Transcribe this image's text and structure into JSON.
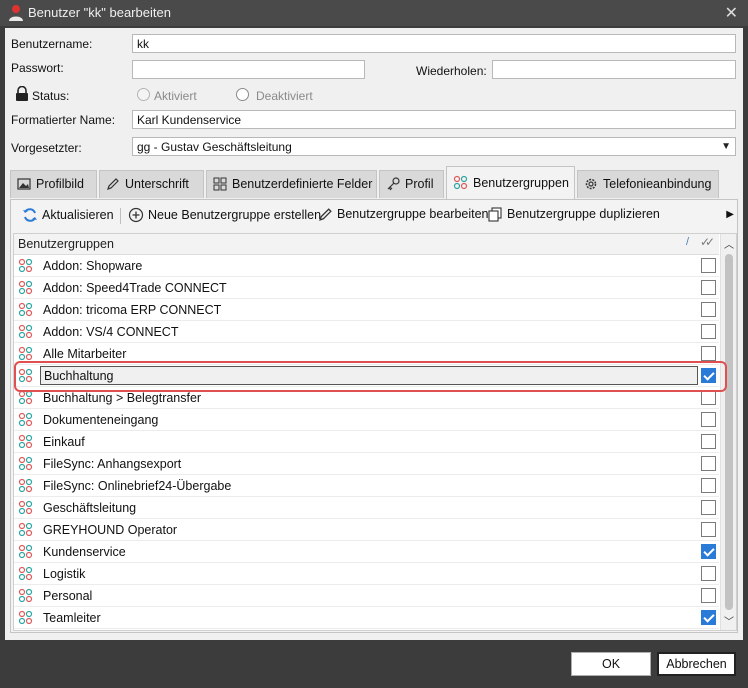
{
  "window": {
    "title": "Benutzer \"kk\" bearbeiten"
  },
  "form": {
    "username_label": "Benutzername:",
    "username_value": "kk",
    "password_label": "Passwort:",
    "password_value": "",
    "repeat_label": "Wiederholen:",
    "repeat_value": "",
    "status_label": "Status:",
    "status_active": "Aktiviert",
    "status_inactive": "Deaktiviert",
    "formatted_name_label": "Formatierter Name:",
    "formatted_name_value": "Karl Kundenservice",
    "supervisor_label": "Vorgesetzter:",
    "supervisor_value": "gg - Gustav Geschäftsleitung"
  },
  "tabs": [
    {
      "label": "Profilbild",
      "icon": "image-icon"
    },
    {
      "label": "Unterschrift",
      "icon": "pen-icon"
    },
    {
      "label": "Benutzerdefinierte Felder",
      "icon": "grid-icon"
    },
    {
      "label": "Profil",
      "icon": "key-icon"
    },
    {
      "label": "Benutzergruppen",
      "icon": "group-icon",
      "active": true
    },
    {
      "label": "Telefonieanbindung",
      "icon": "gear-icon"
    }
  ],
  "toolbar": {
    "refresh": "Aktualisieren",
    "new_group": "Neue Benutzergruppe erstellen",
    "edit_group": "Benutzergruppe bearbeiten",
    "duplicate_group": "Benutzergruppe duplizieren"
  },
  "grid": {
    "header": "Benutzergruppen",
    "rows": [
      {
        "name": "Addon: Shopware",
        "checked": false
      },
      {
        "name": "Addon: Speed4Trade CONNECT",
        "checked": false
      },
      {
        "name": "Addon: tricoma ERP CONNECT",
        "checked": false
      },
      {
        "name": "Addon: VS/4 CONNECT",
        "checked": false
      },
      {
        "name": "Alle Mitarbeiter",
        "checked": false
      },
      {
        "name": "Buchhaltung",
        "checked": true,
        "selected": true
      },
      {
        "name": "Buchhaltung > Belegtransfer",
        "checked": false
      },
      {
        "name": "Dokumenteneingang",
        "checked": false
      },
      {
        "name": "Einkauf",
        "checked": false
      },
      {
        "name": "FileSync: Anhangsexport",
        "checked": false
      },
      {
        "name": "FileSync: Onlinebrief24-Übergabe",
        "checked": false
      },
      {
        "name": "Geschäftsleitung",
        "checked": false
      },
      {
        "name": "GREYHOUND Operator",
        "checked": false
      },
      {
        "name": "Kundenservice",
        "checked": true
      },
      {
        "name": "Logistik",
        "checked": false
      },
      {
        "name": "Personal",
        "checked": false
      },
      {
        "name": "Teamleiter",
        "checked": true
      }
    ]
  },
  "footer": {
    "ok": "OK",
    "cancel": "Abbrechen"
  },
  "colors": {
    "accent": "#2a7ad8",
    "highlight": "#e05050",
    "titlebar": "#4a4a4a"
  }
}
